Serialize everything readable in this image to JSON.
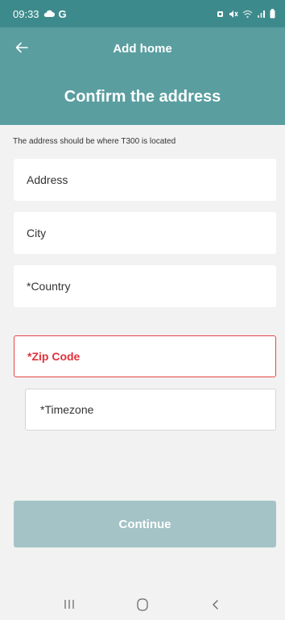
{
  "status": {
    "time": "09:33",
    "carrier": "G",
    "icons": [
      "cloud-icon",
      "alarm-icon",
      "mute-icon",
      "wifi-icon",
      "signal-icon",
      "battery-icon"
    ]
  },
  "appbar": {
    "title": "Add home",
    "back_icon": "arrow-left-icon"
  },
  "header": {
    "title": "Confirm the address"
  },
  "form": {
    "hint": "The address should be where T300 is located",
    "fields": [
      {
        "placeholder": "Address"
      },
      {
        "placeholder": "City"
      },
      {
        "placeholder": "*Country"
      },
      {
        "placeholder": "*Zip Code",
        "state": "error"
      },
      {
        "placeholder": "*Timezone"
      }
    ],
    "continue_label": "Continue"
  },
  "colors": {
    "status_bar": "#3d8a8c",
    "header": "#5a9ea0",
    "error": "#e0323c",
    "button_disabled": "#a4c3c7",
    "background": "#f2f2f2"
  },
  "navbar": {
    "icons": [
      "recents-icon",
      "home-icon",
      "back-nav-icon"
    ]
  }
}
